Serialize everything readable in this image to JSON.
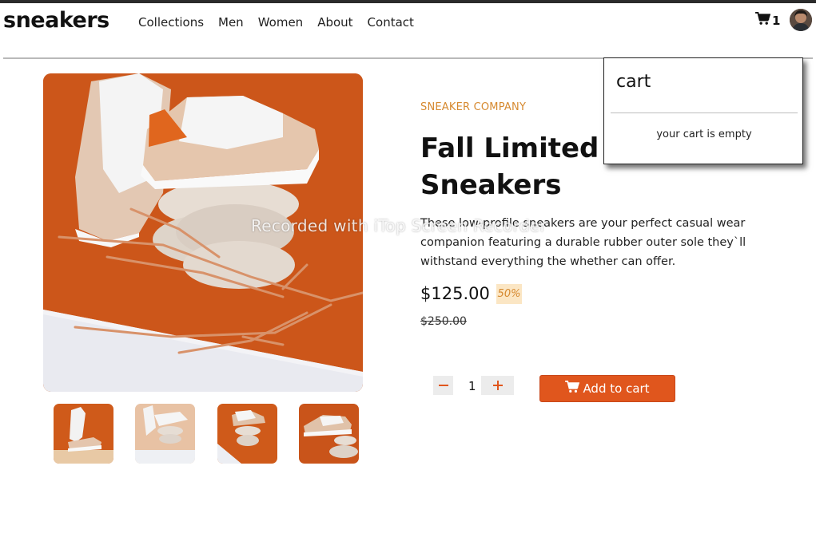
{
  "header": {
    "logo": "sneakers",
    "nav": [
      "Collections",
      "Men",
      "Women",
      "About",
      "Contact"
    ],
    "cart_count": "1"
  },
  "product": {
    "company": "SNEAKER COMPANY",
    "title": "Fall Limited Edition Sneakers",
    "description": "These low-profile sneakers are your perfect casual wear companion featuring a durable rubber outer sole they`ll withstand everything the whether can offer.",
    "price": "$125.00",
    "discount": "50%",
    "old_price": "$250.00",
    "quantity": "1",
    "add_to_cart_label": "Add to cart"
  },
  "gallery": {
    "thumbnails": [
      "thumbnail-1",
      "thumbnail-2",
      "thumbnail-3",
      "thumbnail-4"
    ]
  },
  "cart_panel": {
    "title": "cart",
    "empty_message": "your cart is empty"
  },
  "watermark": "Recorded with iTop Screen Recorder",
  "colors": {
    "accent": "#e0561d",
    "brand_label": "#d6892f",
    "discount_bg": "#fbe6c4",
    "image_orange": "#cf5a1a"
  },
  "icons": [
    "cart-icon",
    "avatar",
    "minus-icon",
    "plus-icon",
    "cart-icon-white"
  ]
}
